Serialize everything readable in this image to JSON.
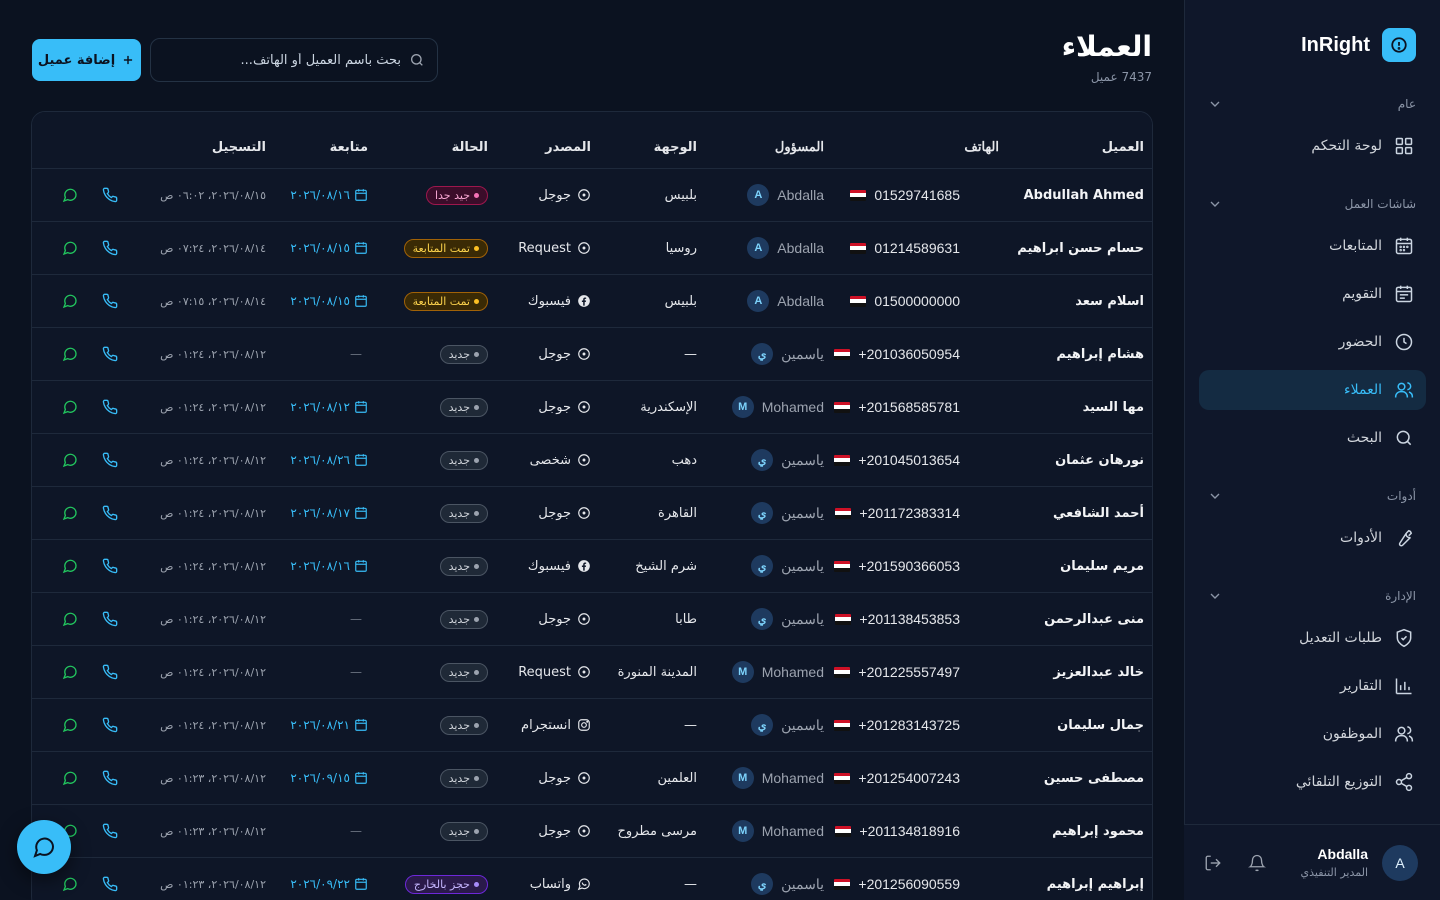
{
  "app": {
    "name": "InRight"
  },
  "colors": {
    "accent": "#38bdf8",
    "background": "#0b1220",
    "sidebar": "#0f172a"
  },
  "sidebar": {
    "sections": [
      {
        "title": "عام",
        "items": [
          {
            "label": "لوحة التحكم",
            "icon": "dashboard-icon"
          }
        ]
      },
      {
        "title": "شاشات العمل",
        "items": [
          {
            "label": "المتابعات",
            "icon": "calendar-icon"
          },
          {
            "label": "التقويم",
            "icon": "calendar-grid-icon"
          },
          {
            "label": "الحضور",
            "icon": "clock-icon"
          },
          {
            "label": "العملاء",
            "icon": "users-icon",
            "active": true
          },
          {
            "label": "البحث",
            "icon": "search-icon"
          }
        ]
      },
      {
        "title": "أدوات",
        "items": [
          {
            "label": "الأدوات",
            "icon": "wrench-icon"
          }
        ]
      },
      {
        "title": "الإدارة",
        "items": [
          {
            "label": "طلبات التعديل",
            "icon": "shield-check-icon"
          },
          {
            "label": "التقارير",
            "icon": "bar-chart-icon"
          },
          {
            "label": "الموظفون",
            "icon": "users-icon"
          },
          {
            "label": "التوزيع التلقائي",
            "icon": "share-icon"
          }
        ]
      }
    ],
    "user": {
      "name": "Abdalla",
      "role": "المدير التنفيذي",
      "initial": "A"
    }
  },
  "header": {
    "title": "العملاء",
    "subtitle": "7437 عميل",
    "search_placeholder": "بحث باسم العميل أو الهاتف...",
    "add_label": "إضافة عميل"
  },
  "table": {
    "columns": {
      "client": "العميل",
      "phone": "الهاتف",
      "owner": "المسؤول",
      "destination": "الوجهة",
      "source": "المصدر",
      "status": "الحالة",
      "followup": "متابعة",
      "registered": "التسجيل"
    },
    "rows": [
      {
        "client": "Abdullah Ahmed",
        "phone": "01529741685",
        "owner": "Abdalla",
        "owner_initial": "A",
        "destination": "بلبيس",
        "source": "جوجل",
        "source_icon": "google-icon",
        "status": "جيد جدا",
        "status_kind": "vgood",
        "followup": "٢٠٢٦/٠٨/١٦",
        "registered": "٢٠٢٦/٠٨/١٥، ٠٦:٠٢ ص"
      },
      {
        "client": "حسام حسن ابراهيم",
        "phone": "01214589631",
        "owner": "Abdalla",
        "owner_initial": "A",
        "destination": "روسيا",
        "source": "Request",
        "source_icon": "google-icon",
        "status": "تمت المتابعة",
        "status_kind": "done",
        "followup": "٢٠٢٦/٠٨/١٥",
        "registered": "٢٠٢٦/٠٨/١٤، ٠٧:٢٤ ص"
      },
      {
        "client": "اسلام سعد",
        "phone": "01500000000",
        "owner": "Abdalla",
        "owner_initial": "A",
        "destination": "بلبيس",
        "source": "فيسبوك",
        "source_icon": "facebook-icon",
        "status": "تمت المتابعة",
        "status_kind": "done",
        "followup": "٢٠٢٦/٠٨/١٥",
        "registered": "٢٠٢٦/٠٨/١٤، ٠٧:١٥ ص"
      },
      {
        "client": "هشام إبراهيم",
        "phone": "+201036050954",
        "owner": "ياسمين",
        "owner_initial": "ي",
        "destination": "—",
        "source": "جوجل",
        "source_icon": "google-icon",
        "status": "جديد",
        "status_kind": "new",
        "followup": "",
        "registered": "٢٠٢٦/٠٨/١٢، ٠١:٢٤ ص"
      },
      {
        "client": "مها السيد",
        "phone": "+201568585781",
        "owner": "Mohamed",
        "owner_initial": "M",
        "destination": "الإسكندرية",
        "source": "جوجل",
        "source_icon": "google-icon",
        "status": "جديد",
        "status_kind": "new",
        "followup": "٢٠٢٦/٠٨/١٢",
        "registered": "٢٠٢٦/٠٨/١٢، ٠١:٢٤ ص"
      },
      {
        "client": "نورهان عثمان",
        "phone": "+201045013654",
        "owner": "ياسمين",
        "owner_initial": "ي",
        "destination": "دهب",
        "source": "شخصى",
        "source_icon": "google-icon",
        "status": "جديد",
        "status_kind": "new",
        "followup": "٢٠٢٦/٠٨/٢٦",
        "registered": "٢٠٢٦/٠٨/١٢، ٠١:٢٤ ص"
      },
      {
        "client": "أحمد الشافعي",
        "phone": "+201172383314",
        "owner": "ياسمين",
        "owner_initial": "ي",
        "destination": "القاهرة",
        "source": "جوجل",
        "source_icon": "google-icon",
        "status": "جديد",
        "status_kind": "new",
        "followup": "٢٠٢٦/٠٨/١٧",
        "registered": "٢٠٢٦/٠٨/١٢، ٠١:٢٤ ص"
      },
      {
        "client": "مريم سليمان",
        "phone": "+201590366053",
        "owner": "ياسمين",
        "owner_initial": "ي",
        "destination": "شرم الشيخ",
        "source": "فيسبوك",
        "source_icon": "facebook-icon",
        "status": "جديد",
        "status_kind": "new",
        "followup": "٢٠٢٦/٠٨/١٦",
        "registered": "٢٠٢٦/٠٨/١٢، ٠١:٢٤ ص"
      },
      {
        "client": "منى عبدالرحمن",
        "phone": "+201138453853",
        "owner": "ياسمين",
        "owner_initial": "ي",
        "destination": "طابا",
        "source": "جوجل",
        "source_icon": "google-icon",
        "status": "جديد",
        "status_kind": "new",
        "followup": "",
        "registered": "٢٠٢٦/٠٨/١٢، ٠١:٢٤ ص"
      },
      {
        "client": "خالد عبدالعزيز",
        "phone": "+201225557497",
        "owner": "Mohamed",
        "owner_initial": "M",
        "destination": "المدينة المنورة",
        "source": "Request",
        "source_icon": "google-icon",
        "status": "جديد",
        "status_kind": "new",
        "followup": "",
        "registered": "٢٠٢٦/٠٨/١٢، ٠١:٢٤ ص"
      },
      {
        "client": "جمال سليمان",
        "phone": "+201283143725",
        "owner": "ياسمين",
        "owner_initial": "ي",
        "destination": "—",
        "source": "انستجرام",
        "source_icon": "instagram-icon",
        "status": "جديد",
        "status_kind": "new",
        "followup": "٢٠٢٦/٠٨/٢١",
        "registered": "٢٠٢٦/٠٨/١٢، ٠١:٢٤ ص"
      },
      {
        "client": "مصطفى حسين",
        "phone": "+201254007243",
        "owner": "Mohamed",
        "owner_initial": "M",
        "destination": "العلمين",
        "source": "جوجل",
        "source_icon": "google-icon",
        "status": "جديد",
        "status_kind": "new",
        "followup": "٢٠٢٦/٠٩/١٥",
        "registered": "٢٠٢٦/٠٨/١٢، ٠١:٢٣ ص"
      },
      {
        "client": "محمود إبراهيم",
        "phone": "+201134818916",
        "owner": "Mohamed",
        "owner_initial": "M",
        "destination": "مرسى مطروح",
        "source": "جوجل",
        "source_icon": "google-icon",
        "status": "جديد",
        "status_kind": "new",
        "followup": "",
        "registered": "٢٠٢٦/٠٨/١٢، ٠١:٢٣ ص"
      },
      {
        "client": "إبراهيم إبراهيم",
        "phone": "+201256090559",
        "owner": "ياسمين",
        "owner_initial": "ي",
        "destination": "—",
        "source": "واتساب",
        "source_icon": "whatsapp-icon",
        "status": "حجز بالخارج",
        "status_kind": "booked",
        "followup": "٢٠٢٦/٠٩/٢٢",
        "registered": "٢٠٢٦/٠٨/١٢، ٠١:٢٣ ص"
      }
    ]
  }
}
